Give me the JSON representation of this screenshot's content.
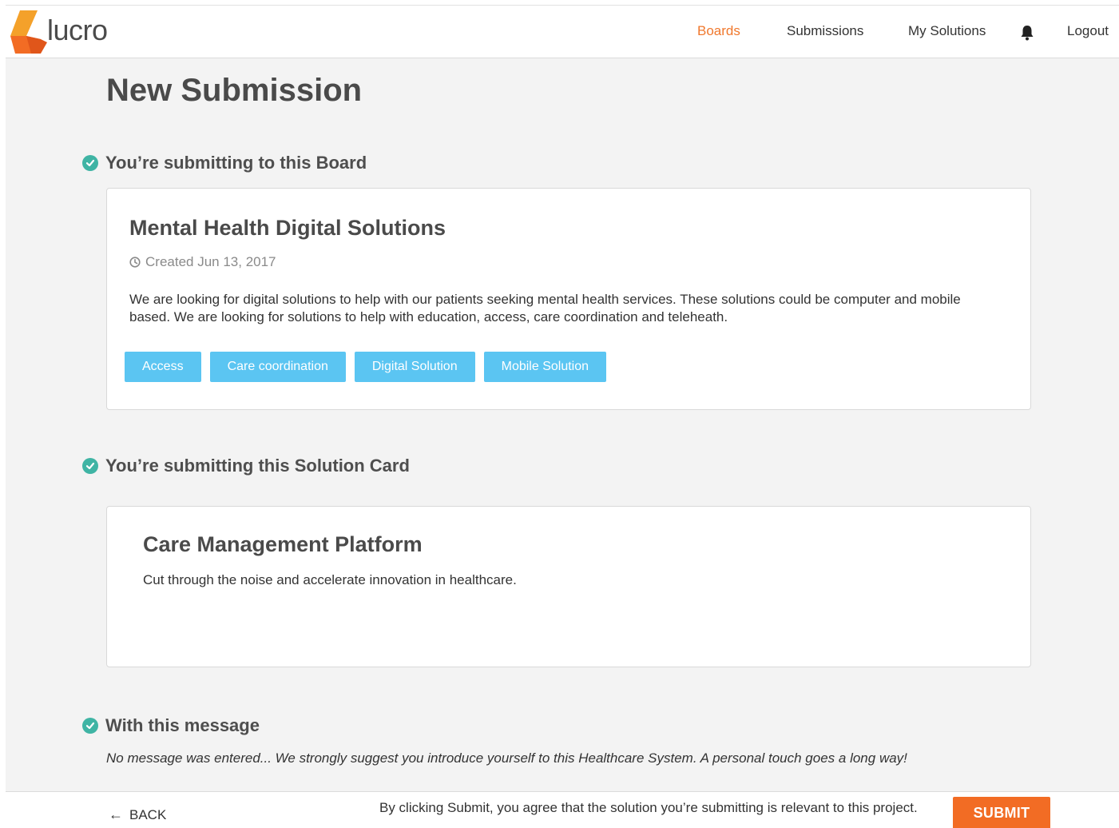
{
  "header": {
    "logo_text": "lucro",
    "nav": {
      "boards": "Boards",
      "submissions": "Submissions",
      "my_solutions": "My Solutions",
      "logout": "Logout"
    },
    "bell_icon": "bell-icon"
  },
  "page": {
    "title": "New Submission"
  },
  "board_section": {
    "heading": "You’re submitting to this Board",
    "board": {
      "title": "Mental Health Digital Solutions",
      "created": "Created Jun 13, 2017",
      "description": "We are looking for digital solutions to help with our patients seeking mental health services. These solutions could be computer and mobile based. We are looking for solutions to help with education, access, care coordination and teleheath.",
      "tags": [
        "Access",
        "Care coordination",
        "Digital Solution",
        "Mobile Solution"
      ]
    }
  },
  "solution_section": {
    "heading": "You’re submitting this Solution Card",
    "solution": {
      "title": "Care Management Platform",
      "description": "Cut through the noise and accelerate innovation in healthcare."
    }
  },
  "message_section": {
    "heading": "With this message",
    "message": "No message was entered... We strongly suggest you introduce yourself to this Healthcare System. A personal touch goes a long way!"
  },
  "footer": {
    "back": "BACK",
    "agreement": "By clicking Submit, you agree that the solution you’re submitting is relevant to this project.",
    "submit": "SUBMIT"
  },
  "colors": {
    "accent_orange": "#f26c24",
    "active_nav": "#f0782d",
    "tag_blue": "#5bc5f2",
    "check_teal": "#3fb4a4"
  }
}
